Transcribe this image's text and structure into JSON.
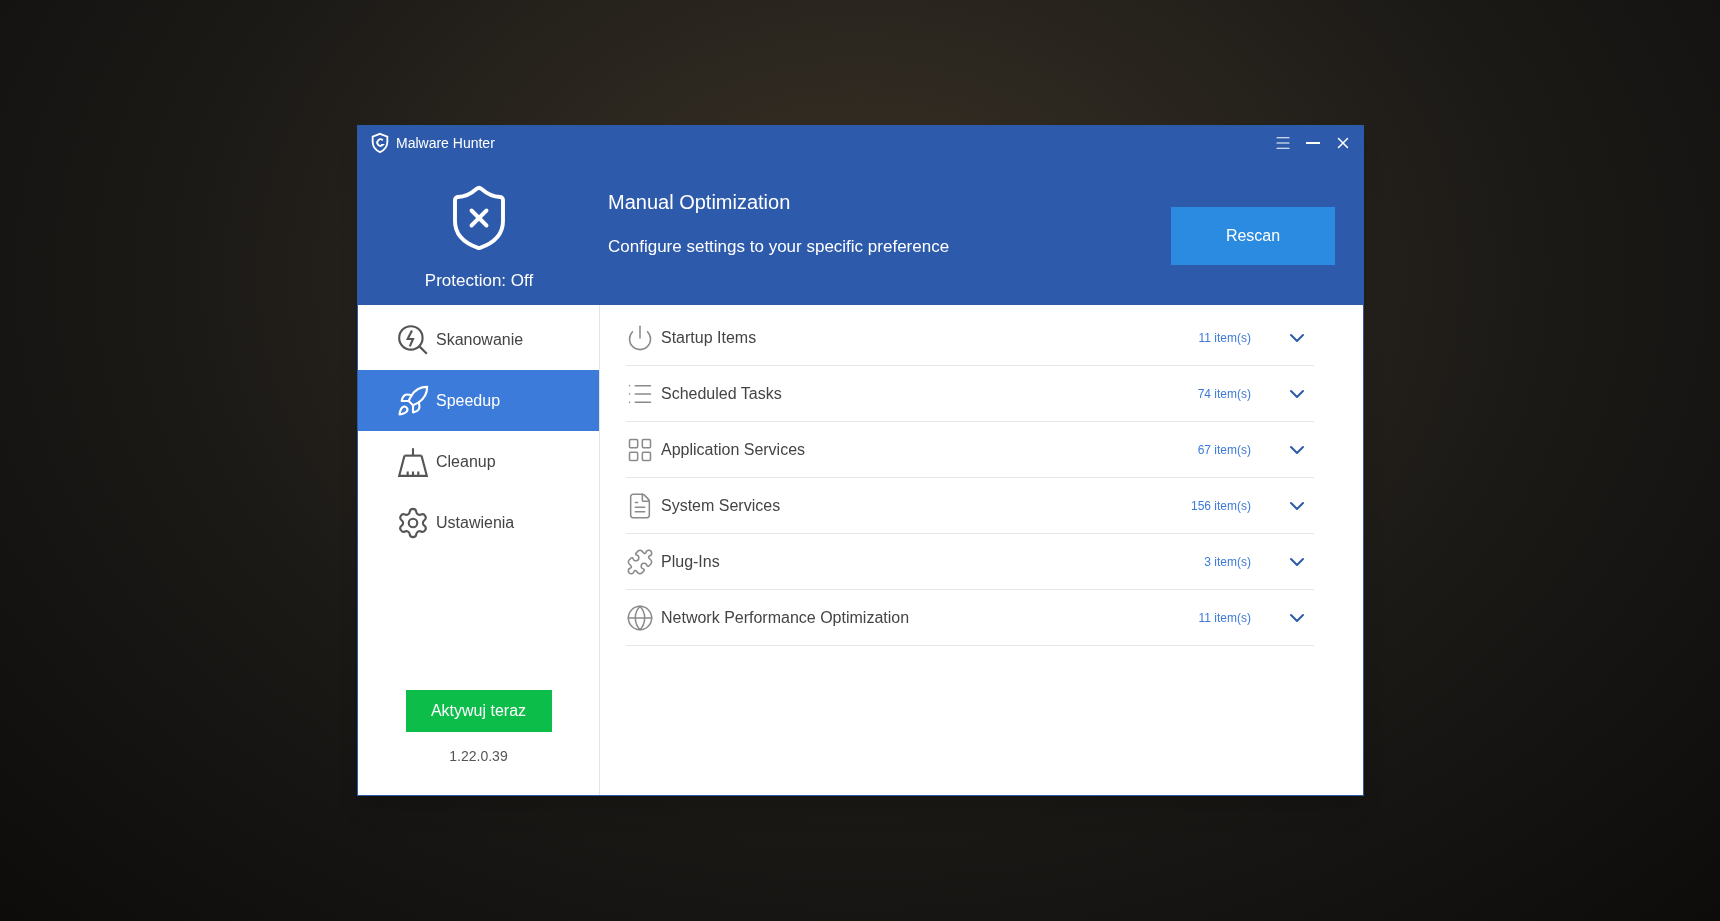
{
  "window": {
    "title": "Malware Hunter"
  },
  "status": {
    "label": "Protection: Off",
    "on": false
  },
  "header": {
    "title": "Manual Optimization",
    "subtitle": "Configure settings to your specific preference",
    "button": "Rescan"
  },
  "sidebar": {
    "items": [
      {
        "label": "Skanowanie",
        "selected": false
      },
      {
        "label": "Speedup",
        "selected": true
      },
      {
        "label": "Cleanup",
        "selected": false
      },
      {
        "label": "Ustawienia",
        "selected": false
      }
    ],
    "activate_button": "Aktywuj teraz",
    "version": "1.22.0.39"
  },
  "categories": [
    {
      "label": "Startup Items",
      "count": "11 item(s)",
      "expanded": false
    },
    {
      "label": "Scheduled Tasks",
      "count": "74 item(s)",
      "expanded": false
    },
    {
      "label": "Application Services",
      "count": "67 item(s)",
      "expanded": false
    },
    {
      "label": "System Services",
      "count": "156 item(s)",
      "expanded": false
    },
    {
      "label": "Plug-Ins",
      "count": "3 item(s)",
      "expanded": false
    },
    {
      "label": "Network Performance Optimization",
      "count": "11 item(s)",
      "expanded": false
    }
  ]
}
